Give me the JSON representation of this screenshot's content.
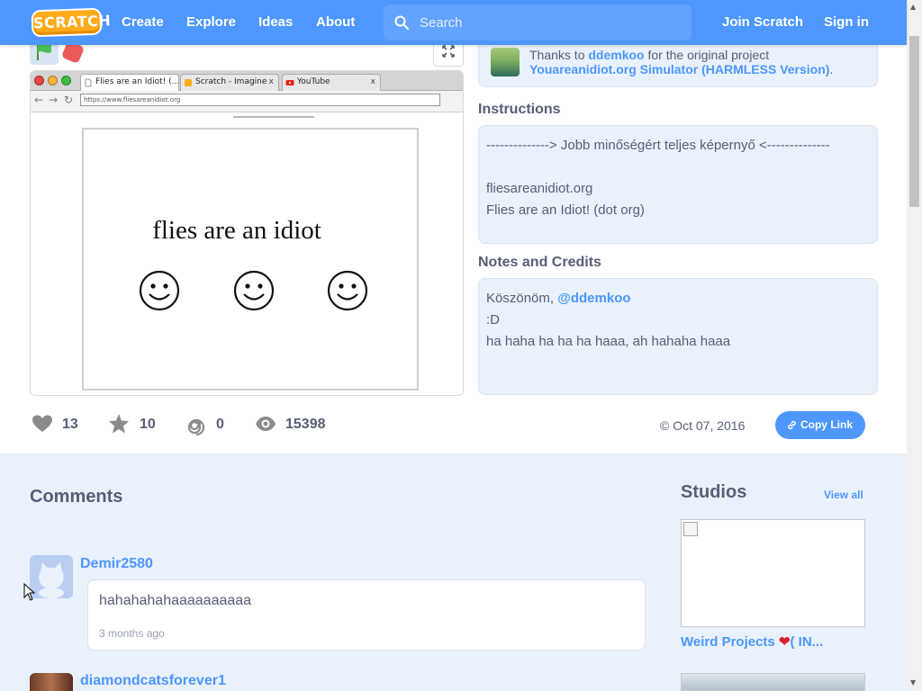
{
  "nav": {
    "logo": "SCRATCH",
    "links": [
      "Create",
      "Explore",
      "Ideas",
      "About"
    ],
    "search_placeholder": "Search",
    "join": "Join Scratch",
    "signin": "Sign in"
  },
  "player": {
    "browser_tabs": [
      "Flies are an Idiot! (...",
      "Scratch - Imagine",
      "YouTube"
    ],
    "tab_close": "x",
    "url": "https://www.fliesareanidiot.org",
    "stage_text": "flies are an idiot",
    "smiley": "☺"
  },
  "stats": {
    "loves": "13",
    "favorites": "10",
    "remixes": "0",
    "views": "15398",
    "date": "Oct 07, 2016",
    "date_icon": "©",
    "copy_link": "Copy Link"
  },
  "remix": {
    "prefix": "Thanks to",
    "author": "ddemkoo",
    "middle": "for the original project",
    "project": "Youareanidiot.org Simulator (HARMLESS Version)",
    "suffix": "."
  },
  "instructions": {
    "title": "Instructions",
    "lines": [
      "--------------> Jobb minőségért teljes képernyő <--------------",
      "",
      "fliesareanidiot.org",
      "Flies are an Idiot! (dot org)"
    ]
  },
  "notes": {
    "title": "Notes and Credits",
    "line1_prefix": "Köszönöm,",
    "line1_mention": "@ddemkoo",
    "line2": ":D",
    "line3": "ha haha ha ha ha haaa, ah hahaha haaa"
  },
  "comments": {
    "title": "Comments",
    "items": [
      {
        "user": "Demir2580",
        "text": "hahahahahaaaaaaaaaa",
        "time": "3 months ago"
      },
      {
        "user": "diamondcatsforever1"
      }
    ]
  },
  "studios": {
    "title": "Studios",
    "view_all": "View all",
    "items": [
      {
        "name": "Weird Projects",
        "heart": "❤",
        "suffix": "( IN..."
      }
    ]
  },
  "colors": {
    "brand_blue": "#4d97ff",
    "logo_orange": "#ffab19",
    "stop_red": "#ec5959",
    "text_gray": "#575e75"
  }
}
